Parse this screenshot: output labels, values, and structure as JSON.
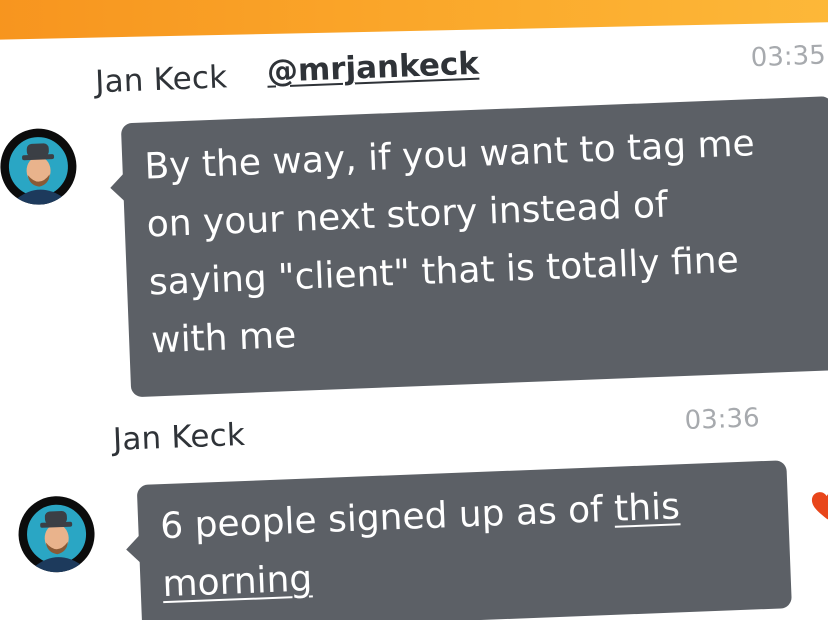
{
  "colors": {
    "top_bar": "#f7941e",
    "bubble": "#5c6066",
    "bubble_text": "#ffffff",
    "timestamp": "#a7aaae",
    "sender": "#2f3338",
    "heart": "#e8461b"
  },
  "messages": [
    {
      "sender": "Jan Keck",
      "handle": "@mrjankeck",
      "time": "03:35",
      "lines": [
        "By the way, if you want to tag me",
        "on your next story instead of",
        "saying \"client\" that is totally fine",
        "with me"
      ],
      "avatar_icon": "user-avatar"
    },
    {
      "sender": "Jan Keck",
      "time": "03:36",
      "text_before_link": "6 people signed up as of ",
      "link_part1": "this",
      "link_part2": "morning",
      "avatar_icon": "user-avatar",
      "reaction_icon": "heart-icon"
    }
  ]
}
